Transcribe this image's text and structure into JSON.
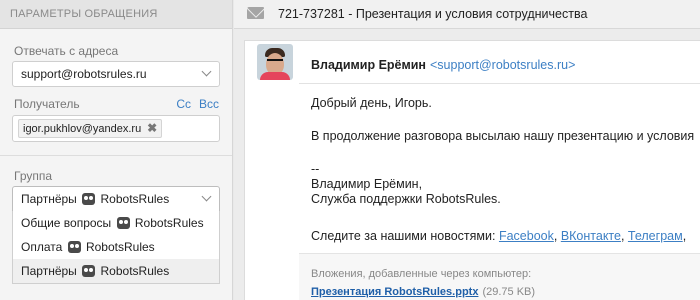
{
  "left_panel": {
    "header": "ПАРАМЕТРЫ ОБРАЩЕНИЯ",
    "reply_from": {
      "label": "Отвечать с адреса",
      "value": "support@robotsrules.ru"
    },
    "recipient": {
      "label": "Получатель",
      "cc": "Cc",
      "bcc": "Bcc",
      "chip": "igor.pukhlov@yandex.ru"
    },
    "group": {
      "label": "Группа",
      "selected": "Партнёры",
      "brand": "RobotsRules",
      "options": [
        {
          "label": "Общие вопросы",
          "brand": "RobotsRules"
        },
        {
          "label": "Оплата",
          "brand": "RobotsRules"
        },
        {
          "label": "Партнёры",
          "brand": "RobotsRules"
        }
      ]
    }
  },
  "ticket": {
    "title": "721-737281 - Презентация и условия сотрудничества"
  },
  "message": {
    "sender_name": "Владимир Ерёмин",
    "sender_email": "<support@robotsrules.ru>",
    "lines": {
      "greeting": "Добрый день, Игорь.",
      "intro": "В продолжение разговора высылаю нашу презентацию и условия",
      "sig_dash": "--",
      "sig_name": "Владимир Ерёмин,",
      "sig_team": "Служба поддержки RobotsRules.",
      "follow": "Следите за нашими новостями:",
      "facebook": "Facebook",
      "vk": "ВКонтакте",
      "telegram": "Телеграм"
    },
    "attachments": {
      "label": "Вложения, добавленные через компьютер:",
      "file_name": "Презентация RobotsRules.pptx",
      "file_size": "(29.75 KB)"
    }
  },
  "colors": {
    "link": "#3c7fc4",
    "panel_bg": "#f4f4f4"
  }
}
